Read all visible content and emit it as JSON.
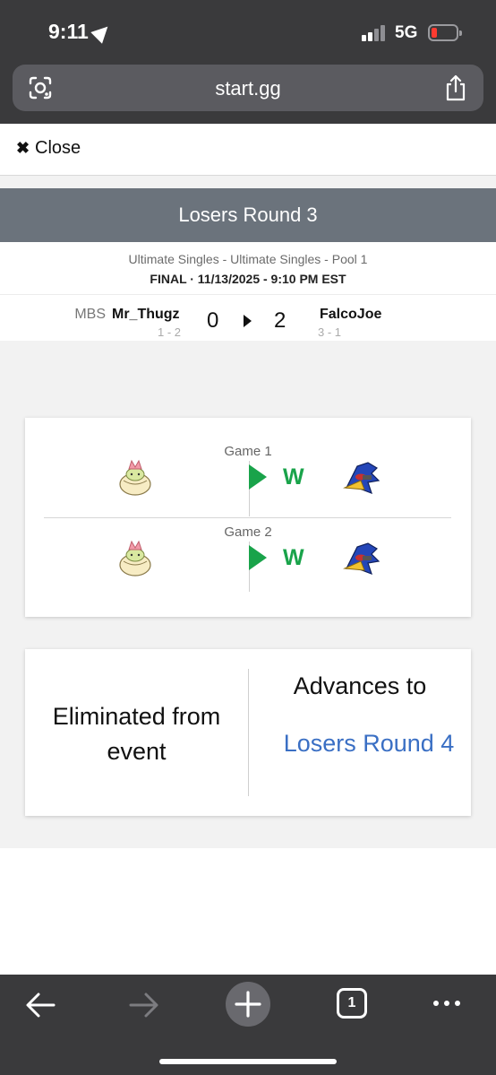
{
  "status_bar": {
    "time": "9:11",
    "network": "5G",
    "battery_color": "#ff3b30"
  },
  "browser": {
    "url": "start.gg",
    "tab_count": "1",
    "icons": [
      "lens-icon",
      "share-icon",
      "back-arrow-icon",
      "forward-arrow-icon",
      "plus-icon",
      "tabs-icon",
      "more-icon"
    ]
  },
  "overlay": {
    "close_label": "Close"
  },
  "match": {
    "round": "Losers Round 3",
    "event": "Ultimate Singles - Ultimate Singles - Pool 1",
    "status_line": "FINAL · 11/13/2025 - 9:10 PM EST",
    "player1": {
      "prefix": "MBS",
      "name": "Mr_Thugz",
      "record": "1 - 2",
      "score": "0"
    },
    "player2": {
      "name": "FalcoJoe",
      "record": "3 - 1",
      "score": "2"
    },
    "games": [
      {
        "label": "Game 1",
        "result": "W",
        "left_character": "bowser-jr-icon",
        "right_character": "falco-icon"
      },
      {
        "label": "Game 2",
        "result": "W",
        "left_character": "bowser-jr-icon",
        "right_character": "falco-icon"
      }
    ]
  },
  "outcome": {
    "loser_text": "Eliminated from event",
    "advance_title": "Advances to",
    "advance_link": "Losers Round 4"
  },
  "colors": {
    "header_bg": "#6b737c",
    "win_green": "#19a34a",
    "link_blue": "#3a6fc4"
  }
}
